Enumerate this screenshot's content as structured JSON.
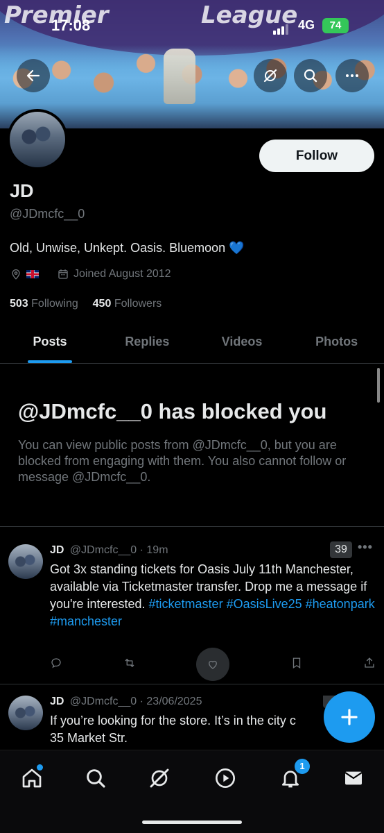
{
  "status_bar": {
    "time": "17:08",
    "network": "4G",
    "battery": "74"
  },
  "banner": {
    "text_left": "Premier",
    "text_right": "League"
  },
  "profile": {
    "follow_label": "Follow",
    "name": "JD",
    "handle": "@JDmcfc__0",
    "bio": "Old, Unwise, Unkept. Oasis. Bluemoon",
    "bio_emoji": "💙",
    "joined": "Joined August 2012",
    "following_count": "503",
    "following_label": "Following",
    "followers_count": "450",
    "followers_label": "Followers"
  },
  "tabs": [
    "Posts",
    "Replies",
    "Videos",
    "Photos"
  ],
  "blocked": {
    "title": "@JDmcfc__0 has blocked you",
    "text": "You can view public posts from @JDmcfc__0, but you are blocked from engaging with them. You also cannot follow or message @JDmcfc__0."
  },
  "posts": [
    {
      "name": "JD",
      "handle": "@JDmcfc__0",
      "time": "· 19m",
      "badge": "39",
      "text": "Got 3x standing tickets for Oasis July 11th Manchester, available via Ticketmaster transfer. Drop me a message if you're interested.",
      "hashtags": "#ticketmaster #OasisLive25 #heatonpark #manchester"
    },
    {
      "name": "JD",
      "handle": "@JDmcfc__0",
      "time": "· 23/06/2025",
      "text_line1": "If you’re looking for the store. It’s in the city c",
      "text_line2": "35 Market Str."
    }
  ],
  "bottom_nav": {
    "notifications_badge": "1"
  },
  "colors": {
    "accent": "#1d9bf0",
    "background": "#000000",
    "muted": "#71767b"
  }
}
